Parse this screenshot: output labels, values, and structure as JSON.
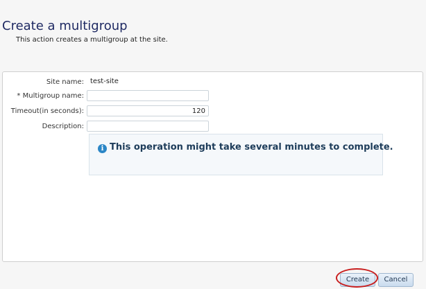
{
  "header": {
    "title": "Create a multigroup",
    "subtitle": "This action creates a multigroup at the site."
  },
  "form": {
    "site_name_label": "Site name:",
    "site_name_value": "test-site",
    "multigroup_label": "* Multigroup name:",
    "multigroup_value": "",
    "timeout_label": "Timeout(in seconds):",
    "timeout_value": "120",
    "description_label": "Description:",
    "description_value": ""
  },
  "info": {
    "icon": "info-icon",
    "message": "This operation might take several minutes to complete."
  },
  "buttons": {
    "create_label": "Create",
    "cancel_label": "Cancel"
  },
  "colors": {
    "title": "#1f2a63",
    "highlight_ring": "#c81e1e",
    "info_icon": "#2b86c6"
  }
}
